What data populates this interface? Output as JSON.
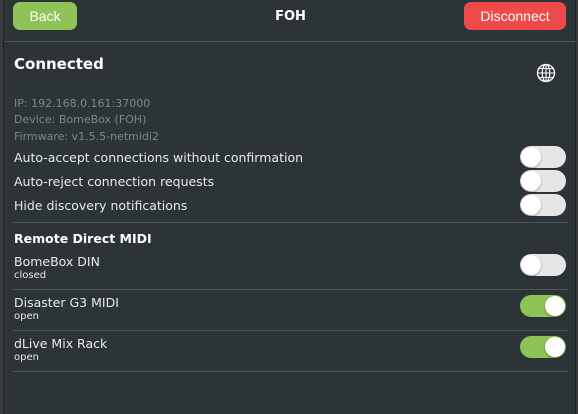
{
  "header": {
    "back_label": "Back",
    "title": "FOH",
    "disconnect_label": "Disconnect"
  },
  "status": {
    "title": "Connected",
    "ip": "IP: 192.168.0.161:37000",
    "device": "Device: BomeBox (FOH)",
    "firmware": "Firmware: v1.5.5-netmidi2",
    "globe_icon": "globe-icon"
  },
  "settings": [
    {
      "label": "Auto-accept connections without confirmation",
      "on": false
    },
    {
      "label": "Auto-reject connection requests",
      "on": false
    },
    {
      "label": "Hide discovery notifications",
      "on": false
    }
  ],
  "remote_midi": {
    "title": "Remote Direct MIDI",
    "ports": [
      {
        "name": "BomeBox DIN",
        "state": "closed",
        "on": false
      },
      {
        "name": "Disaster G3 MIDI",
        "state": "open",
        "on": true
      },
      {
        "name": "dLive Mix Rack",
        "state": "open",
        "on": true
      }
    ]
  },
  "colors": {
    "accent_green": "#8fc257",
    "danger_red": "#ee4a4a",
    "panel_bg": "#2c3437",
    "toggle_off": "#e6e6e6"
  }
}
